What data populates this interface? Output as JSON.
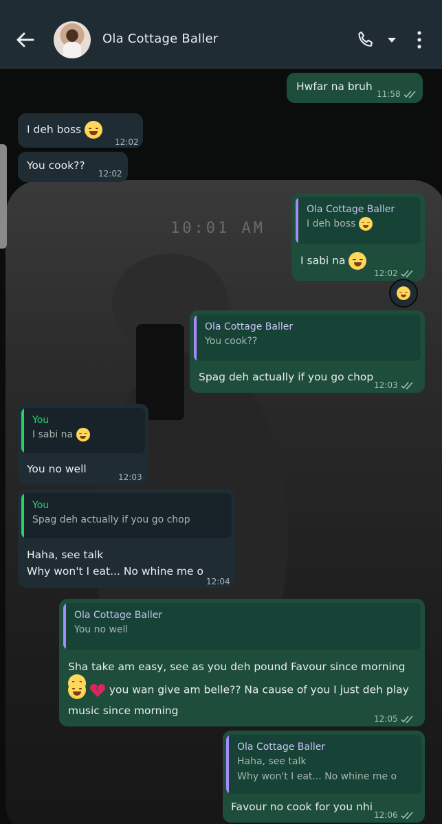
{
  "header": {
    "title": "Ola Cottage Baller",
    "icons": [
      "back-arrow-icon",
      "contact-avatar",
      "phone-icon",
      "dropdown-caret-icon",
      "more-vertical-icon"
    ]
  },
  "wallpaper": {
    "stamp": "10:01 AM"
  },
  "messages": [
    {
      "dir": "out",
      "text": "Hwfar na bruh",
      "time": "11:58"
    },
    {
      "dir": "in",
      "text": "I deh boss",
      "emoji": "relieved-face",
      "time": "12:02"
    },
    {
      "dir": "in",
      "text": "You cook??",
      "time": "12:02"
    },
    {
      "dir": "out",
      "quote_name": "Ola Cottage Baller",
      "quote_text": "I deh boss",
      "text": "I sabi na",
      "emoji": "tears-of-joy",
      "time": "12:02",
      "reaction": "tears-of-joy"
    },
    {
      "dir": "out",
      "quote_name": "Ola Cottage Baller",
      "quote_text": "You cook??",
      "text": "Spag deh actually if you go chop",
      "time": "12:03"
    },
    {
      "dir": "in",
      "quote_name": "You",
      "quote_text": "I sabi na",
      "text": "You no well",
      "time": "12:03"
    },
    {
      "dir": "in",
      "quote_name": "You",
      "quote_text": "Spag deh actually if you go chop",
      "text_line1": "Haha, see talk",
      "text_line2": "Why won't I eat... No whine me o",
      "time": "12:04"
    },
    {
      "dir": "out",
      "quote_name": "Ola Cottage Baller",
      "quote_text": "You no well",
      "text_line1": "Sha take am easy, see as you deh pound Favour since morning",
      "text_line2": "you wan give am belle?? Na cause of you I just deh play",
      "text_line3": "music since morning",
      "time": "12:05"
    },
    {
      "dir": "out",
      "quote_name": "Ola Cottage Baller",
      "quote_text_line1": "Haha, see talk",
      "quote_text_line2": "Why won't I eat... No whine me o",
      "text": "Favour no cook for you nhi",
      "time": "12:06"
    }
  ],
  "colors": {
    "header_bg": "#1f2c34",
    "incoming_bubble": "#1f2c34",
    "outgoing_bubble": "#1e4d3b",
    "quote_bar_purple": "#a78bfa",
    "quote_bar_green": "#25d366",
    "quote_name_green": "#25d366",
    "quote_name_purple": "#c9c3f5"
  }
}
